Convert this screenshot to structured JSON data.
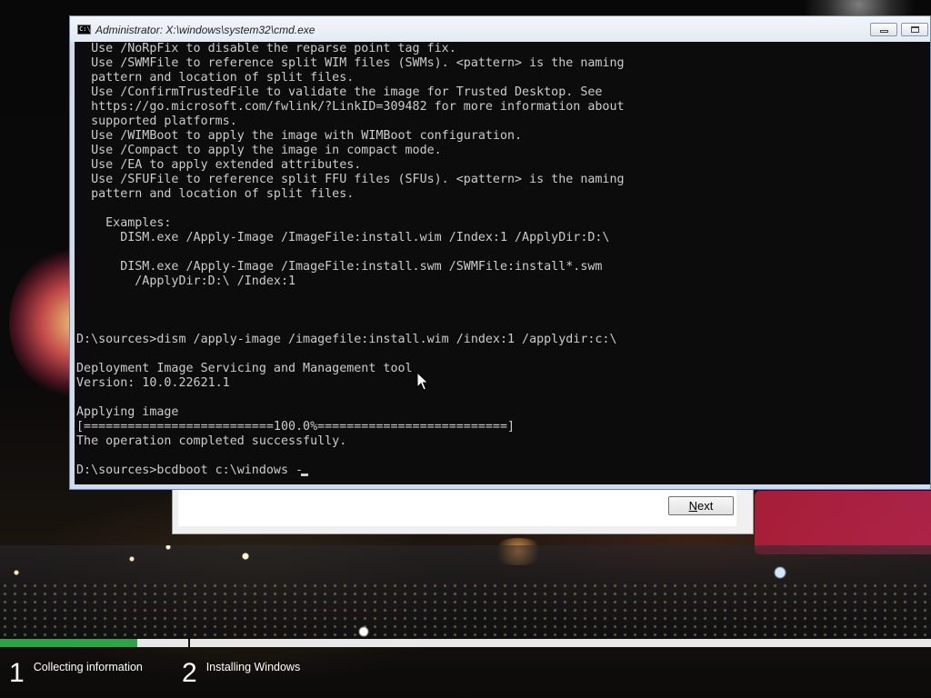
{
  "cmd_window": {
    "title": "Administrator: X:\\windows\\system32\\cmd.exe",
    "console_lines": [
      "  Use /NoRpFix to disable the reparse point tag fix.",
      "  Use /SWMFile to reference split WIM files (SWMs). <pattern> is the naming",
      "  pattern and location of split files.",
      "  Use /ConfirmTrustedFile to validate the image for Trusted Desktop. See",
      "  https://go.microsoft.com/fwlink/?LinkID=309482 for more information about",
      "  supported platforms.",
      "  Use /WIMBoot to apply the image with WIMBoot configuration.",
      "  Use /Compact to apply the image in compact mode.",
      "  Use /EA to apply extended attributes.",
      "  Use /SFUFile to reference split FFU files (SFUs). <pattern> is the naming",
      "  pattern and location of split files.",
      "",
      "    Examples:",
      "      DISM.exe /Apply-Image /ImageFile:install.wim /Index:1 /ApplyDir:D:\\",
      "",
      "      DISM.exe /Apply-Image /ImageFile:install.swm /SWMFile:install*.swm",
      "        /ApplyDir:D:\\ /Index:1",
      "",
      "",
      "",
      "D:\\sources>dism /apply-image /imagefile:install.wim /index:1 /applydir:c:\\",
      "",
      "Deployment Image Servicing and Management tool",
      "Version: 10.0.22621.1",
      "",
      "Applying image",
      "[==========================100.0%==========================]",
      "The operation completed successfully.",
      "",
      "D:\\sources>bcdboot c:\\windows -"
    ]
  },
  "setup_dialog": {
    "next_label": "Next",
    "next_accelerator": "N",
    "next_rest": "ext"
  },
  "setup_progress": {
    "fraction": 0.147,
    "steps": [
      {
        "number": "1",
        "label": "Collecting information"
      },
      {
        "number": "2",
        "label": "Installing Windows"
      }
    ]
  },
  "colors": {
    "progress_fill": "#28a745",
    "console_bg": "#0c0c0c",
    "console_text": "#cccccc"
  }
}
